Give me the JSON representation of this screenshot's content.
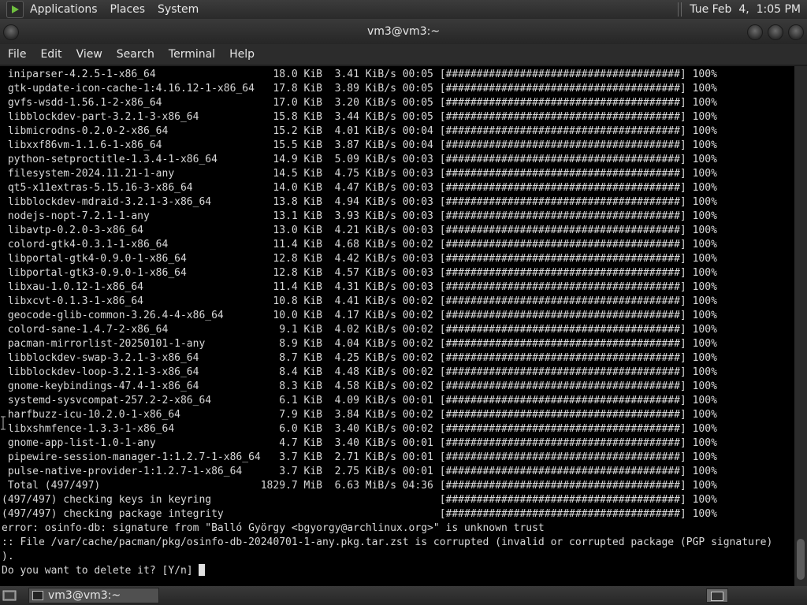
{
  "top_panel": {
    "menus": [
      "Applications",
      "Places",
      "System"
    ],
    "clock": "Tue Feb  4,  1:05 PM"
  },
  "window": {
    "title": "vm3@vm3:~",
    "menu": [
      "File",
      "Edit",
      "View",
      "Search",
      "Terminal",
      "Help"
    ]
  },
  "terminal": {
    "lines": [
      " iniparser-4.2.5-1-x86_64                   18.0 KiB  3.41 KiB/s 00:05 [######################################] 100%",
      " gtk-update-icon-cache-1:4.16.12-1-x86_64   17.8 KiB  3.89 KiB/s 00:05 [######################################] 100%",
      " gvfs-wsdd-1.56.1-2-x86_64                  17.0 KiB  3.20 KiB/s 00:05 [######################################] 100%",
      " libblockdev-part-3.2.1-3-x86_64            15.8 KiB  3.44 KiB/s 00:05 [######################################] 100%",
      " libmicrodns-0.2.0-2-x86_64                 15.2 KiB  4.01 KiB/s 00:04 [######################################] 100%",
      " libxxf86vm-1.1.6-1-x86_64                  15.5 KiB  3.87 KiB/s 00:04 [######################################] 100%",
      " python-setproctitle-1.3.4-1-x86_64         14.9 KiB  5.09 KiB/s 00:03 [######################################] 100%",
      " filesystem-2024.11.21-1-any                14.5 KiB  4.75 KiB/s 00:03 [######################################] 100%",
      " qt5-x11extras-5.15.16-3-x86_64             14.0 KiB  4.47 KiB/s 00:03 [######################################] 100%",
      " libblockdev-mdraid-3.2.1-3-x86_64          13.8 KiB  4.94 KiB/s 00:03 [######################################] 100%",
      " nodejs-nopt-7.2.1-1-any                    13.1 KiB  3.93 KiB/s 00:03 [######################################] 100%",
      " libavtp-0.2.0-3-x86_64                     13.0 KiB  4.21 KiB/s 00:03 [######################################] 100%",
      " colord-gtk4-0.3.1-1-x86_64                 11.4 KiB  4.68 KiB/s 00:02 [######################################] 100%",
      " libportal-gtk4-0.9.0-1-x86_64              12.8 KiB  4.42 KiB/s 00:03 [######################################] 100%",
      " libportal-gtk3-0.9.0-1-x86_64              12.8 KiB  4.57 KiB/s 00:03 [######################################] 100%",
      " libxau-1.0.12-1-x86_64                     11.4 KiB  4.31 KiB/s 00:03 [######################################] 100%",
      " libxcvt-0.1.3-1-x86_64                     10.8 KiB  4.41 KiB/s 00:02 [######################################] 100%",
      " geocode-glib-common-3.26.4-4-x86_64        10.0 KiB  4.17 KiB/s 00:02 [######################################] 100%",
      " colord-sane-1.4.7-2-x86_64                  9.1 KiB  4.02 KiB/s 00:02 [######################################] 100%",
      " pacman-mirrorlist-20250101-1-any            8.9 KiB  4.04 KiB/s 00:02 [######################################] 100%",
      " libblockdev-swap-3.2.1-3-x86_64             8.7 KiB  4.25 KiB/s 00:02 [######################################] 100%",
      " libblockdev-loop-3.2.1-3-x86_64             8.4 KiB  4.48 KiB/s 00:02 [######################################] 100%",
      " gnome-keybindings-47.4-1-x86_64             8.3 KiB  4.58 KiB/s 00:02 [######################################] 100%",
      " systemd-sysvcompat-257.2-2-x86_64           6.1 KiB  4.09 KiB/s 00:01 [######################################] 100%",
      " harfbuzz-icu-10.2.0-1-x86_64                7.9 KiB  3.84 KiB/s 00:02 [######################################] 100%",
      " libxshmfence-1.3.3-1-x86_64                 6.0 KiB  3.40 KiB/s 00:02 [######################################] 100%",
      " gnome-app-list-1.0-1-any                    4.7 KiB  3.40 KiB/s 00:01 [######################################] 100%",
      " pipewire-session-manager-1:1.2.7-1-x86_64   3.7 KiB  2.71 KiB/s 00:01 [######################################] 100%",
      " pulse-native-provider-1:1.2.7-1-x86_64      3.7 KiB  2.75 KiB/s 00:01 [######################################] 100%",
      " Total (497/497)                          1829.7 MiB  6.63 MiB/s 04:36 [######################################] 100%",
      "(497/497) checking keys in keyring                                     [######################################] 100%",
      "(497/497) checking package integrity                                   [######################################] 100%",
      "error: osinfo-db: signature from \"Balló György <bgyorgy@archlinux.org>\" is unknown trust",
      ":: File /var/cache/pacman/pkg/osinfo-db-20240701-1-any.pkg.tar.zst is corrupted (invalid or corrupted package (PGP signature)",
      ").",
      "Do you want to delete it? [Y/n] "
    ]
  },
  "taskbar": {
    "task_label": "vm3@vm3:~"
  }
}
